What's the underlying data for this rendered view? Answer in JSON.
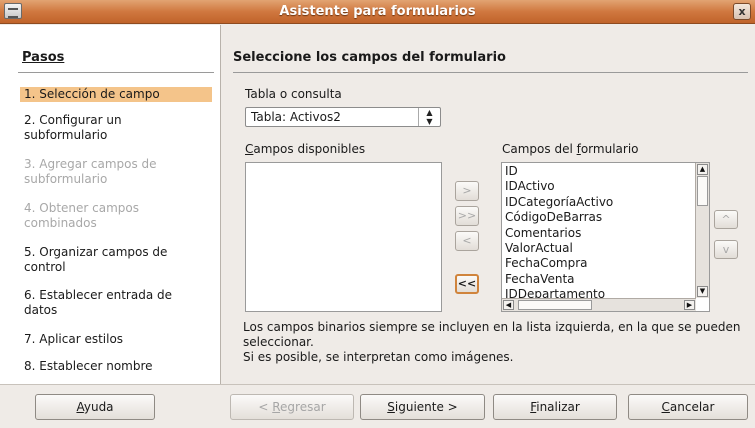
{
  "window": {
    "title": "Asistente para formularios",
    "close_label": "x"
  },
  "steps": {
    "heading": "Pasos",
    "items": [
      {
        "label": "1. Selección de campo",
        "state": "active"
      },
      {
        "label": "2. Configurar un subformulario",
        "state": "normal"
      },
      {
        "label": "3. Agregar campos de subformulario",
        "state": "disabled"
      },
      {
        "label": "4. Obtener campos combinados",
        "state": "disabled"
      },
      {
        "label": "5. Organizar campos de control",
        "state": "normal"
      },
      {
        "label": "6. Establecer entrada de datos",
        "state": "normal"
      },
      {
        "label": "7. Aplicar estilos",
        "state": "normal"
      },
      {
        "label": "8. Establecer nombre",
        "state": "normal"
      }
    ]
  },
  "main": {
    "heading": "Seleccione los campos del formulario",
    "table_label": "Tabla o consulta",
    "table_value": "Tabla: Activos2",
    "available_label_u": "C",
    "available_label_rest": "ampos disponibles",
    "form_label_pre": "Campos del ",
    "form_label_u": "f",
    "form_label_rest": "ormulario",
    "form_fields": [
      "ID",
      "IDActivo",
      "IDCategoríaActivo",
      "CódigoDeBarras",
      "Comentarios",
      "ValorActual",
      "FechaCompra",
      "FechaVenta",
      "IDDepartamento"
    ],
    "move": {
      "add_one": ">",
      "add_all": ">>",
      "remove_one": "<",
      "remove_all": "<<",
      "up": "^",
      "down": "v"
    },
    "note": "Los campos binarios siempre se incluyen en la lista izquierda, en la que se pueden seleccionar.\nSi es posible, se interpretan como imágenes."
  },
  "buttons": {
    "help": {
      "u": "A",
      "rest": "yuda"
    },
    "back": {
      "pre": "< ",
      "u": "R",
      "rest": "egresar"
    },
    "next": {
      "u": "S",
      "rest": "iguiente >"
    },
    "finish": {
      "u": "F",
      "rest": "inalizar"
    },
    "cancel": {
      "u": "C",
      "rest": "ancelar"
    }
  }
}
